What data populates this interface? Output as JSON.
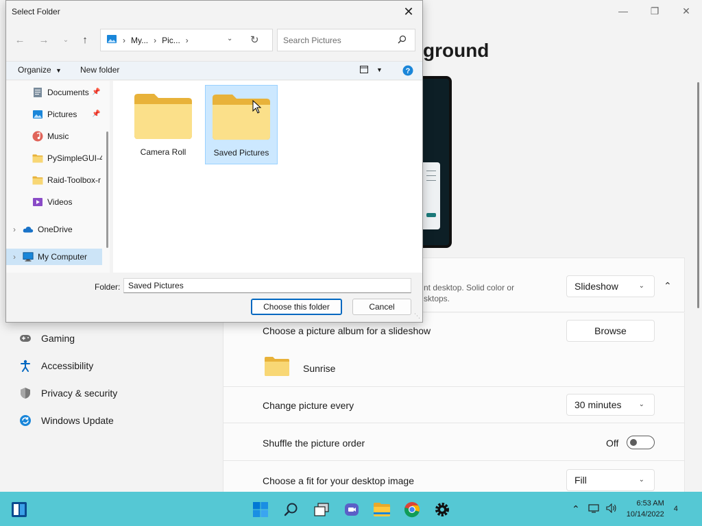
{
  "settings": {
    "title_partial": "ground",
    "nav": [
      {
        "label": "Gaming",
        "icon": "gamepad-icon"
      },
      {
        "label": "Accessibility",
        "icon": "accessibility-icon"
      },
      {
        "label": "Privacy & security",
        "icon": "shield-icon"
      },
      {
        "label": "Windows Update",
        "icon": "update-icon"
      }
    ],
    "background_desc_1": "nt desktop. Solid color or",
    "background_desc_2": "sktops.",
    "background_type": "Slideshow",
    "album_label": "Choose a picture album for a slideshow",
    "browse_label": "Browse",
    "album_name": "Sunrise",
    "change_every_label": "Change picture every",
    "change_every_value": "30 minutes",
    "shuffle_label": "Shuffle the picture order",
    "shuffle_state": "Off",
    "fit_label": "Choose a fit for your desktop image",
    "fit_value": "Fill"
  },
  "dialog": {
    "title": "Select Folder",
    "address": [
      "My...",
      "Pic..."
    ],
    "search_placeholder": "Search Pictures",
    "organize_label": "Organize",
    "new_folder_label": "New folder",
    "tree": [
      {
        "label": "Documents",
        "icon": "documents-icon",
        "pinned": true
      },
      {
        "label": "Pictures",
        "icon": "pictures-icon",
        "pinned": true
      },
      {
        "label": "Music",
        "icon": "music-icon",
        "pinned": false
      },
      {
        "label": "PySimpleGUI-4",
        "icon": "folder-icon",
        "pinned": false
      },
      {
        "label": "Raid-Toolbox-r",
        "icon": "folder-icon",
        "pinned": false
      },
      {
        "label": "Videos",
        "icon": "videos-icon",
        "pinned": false
      },
      {
        "label": "OneDrive",
        "icon": "onedrive-icon",
        "pinned": false
      },
      {
        "label": "My Computer",
        "icon": "computer-icon",
        "pinned": false
      }
    ],
    "folders": [
      {
        "name": "Camera Roll",
        "selected": false
      },
      {
        "name": "Saved Pictures",
        "selected": true
      }
    ],
    "folder_label": "Folder:",
    "folder_value": "Saved Pictures",
    "choose_label": "Choose this folder",
    "cancel_label": "Cancel"
  },
  "taskbar": {
    "time": "6:53 AM",
    "date": "10/14/2022",
    "notification_count": "4"
  },
  "colors": {
    "taskbar": "#55c8d4",
    "selection": "#cce8ff",
    "accent": "#0067c0",
    "folder": "#f8d775"
  }
}
